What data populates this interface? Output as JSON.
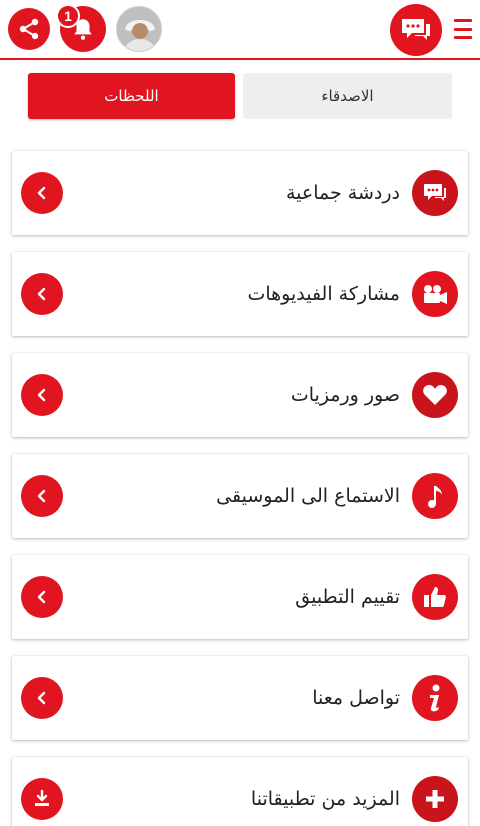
{
  "header": {
    "notification_count": "1",
    "icons": {
      "share": "share-icon",
      "notifications": "bell-icon",
      "avatar": "user-avatar",
      "logo": "chat-bubbles-icon",
      "menu": "hamburger-menu-icon"
    }
  },
  "tabs": [
    {
      "label": "اللحظات",
      "active": true
    },
    {
      "label": "الاصدقاء",
      "active": false
    }
  ],
  "menu_items": [
    {
      "label": "دردشة جماعية",
      "icon": "chat-icon",
      "action_icon": "chevron-left-icon"
    },
    {
      "label": "مشاركة الفيديوهات",
      "icon": "video-camera-icon",
      "action_icon": "chevron-left-icon"
    },
    {
      "label": "صور ورمزيات",
      "icon": "heart-icon",
      "action_icon": "chevron-left-icon"
    },
    {
      "label": "الاستماع الى الموسيقى",
      "icon": "music-note-icon",
      "action_icon": "chevron-left-icon"
    },
    {
      "label": "تقييم التطبيق",
      "icon": "thumbs-up-icon",
      "action_icon": "chevron-left-icon"
    },
    {
      "label": "تواصل معنا",
      "icon": "info-icon",
      "action_icon": "chevron-left-icon"
    },
    {
      "label": "المزيد من تطبيقاتنا",
      "icon": "plus-icon",
      "action_icon": "download-icon"
    }
  ],
  "colors": {
    "accent": "#e0151f",
    "tab_inactive_bg": "#eeeeee",
    "text": "#222222"
  }
}
